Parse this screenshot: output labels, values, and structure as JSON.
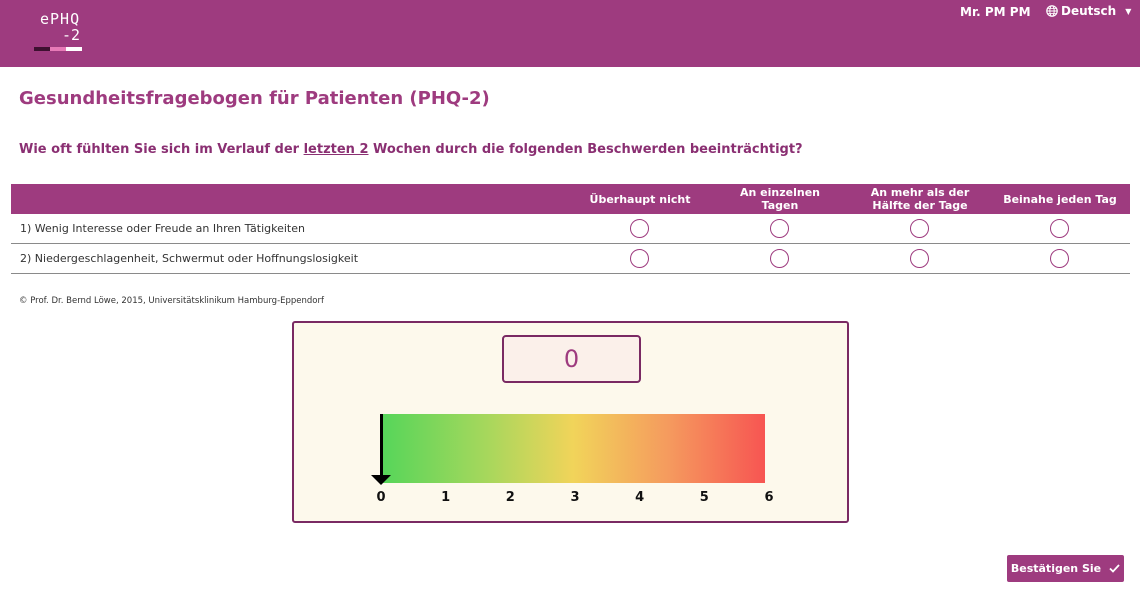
{
  "header": {
    "logo_line1": "ePHQ",
    "logo_line2": "-2",
    "user_name": "Mr. PM PM",
    "language": "Deutsch",
    "language_icon": "globe-icon"
  },
  "colors": {
    "brand": "#9e3b7f",
    "brand_dark": "#7a2a63",
    "panel_bg": "#fdf9ec"
  },
  "page": {
    "title": "Gesundheitsfragebogen für Patienten (PHQ-2)",
    "question_before": "Wie oft fühlten Sie sich im Verlauf der ",
    "question_underlined": "letzten 2",
    "question_after": " Wochen durch die folgenden Beschwerden beeinträchtigt?"
  },
  "table": {
    "columns": [
      "Überhaupt nicht",
      "An einzelnen Tagen",
      "An mehr als der Hälfte der Tage",
      "Beinahe jeden Tag"
    ],
    "rows": [
      {
        "label": "1) Wenig Interesse oder Freude an Ihren Tätigkeiten",
        "selected": null
      },
      {
        "label": "2) Niedergeschlagenheit, Schwermut oder Hoffnungslosigkeit",
        "selected": null
      }
    ]
  },
  "copyright": "© Prof. Dr. Bernd Löwe, 2015, Universitätsklinikum Hamburg-Eppendorf",
  "score": {
    "value": "0",
    "min": 0,
    "max": 6,
    "ticks": [
      "0",
      "1",
      "2",
      "3",
      "4",
      "5",
      "6"
    ]
  },
  "confirm": {
    "label": "Bestätigen Sie",
    "icon": "check-icon"
  }
}
